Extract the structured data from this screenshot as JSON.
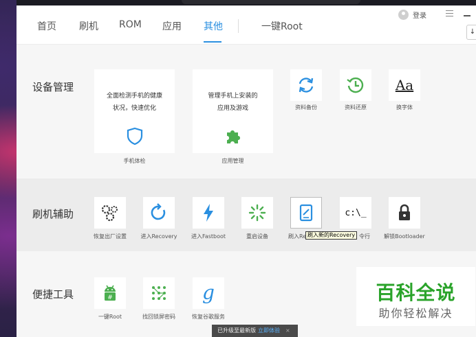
{
  "header": {
    "tabs": [
      {
        "label": "首页"
      },
      {
        "label": "刷机"
      },
      {
        "label": "ROM"
      },
      {
        "label": "应用"
      },
      {
        "label": "其他"
      },
      {
        "label": "一键Root"
      }
    ],
    "active_tab": "其他",
    "login_label": "登录"
  },
  "sections": {
    "device": {
      "title": "设备管理",
      "big_cards": [
        {
          "desc_line1": "全面检测手机的健康",
          "desc_line2": "状况，快速优化",
          "label": "手机体检",
          "icon": "shield-icon"
        },
        {
          "desc_line1": "管理手机上安装的",
          "desc_line2": "应用及游戏",
          "label": "应用管理",
          "icon": "puzzle-icon"
        }
      ],
      "tools": [
        {
          "label": "资料备份",
          "icon": "sync-icon"
        },
        {
          "label": "资料还原",
          "icon": "history-icon"
        },
        {
          "label": "换字体",
          "icon": "font-icon",
          "glyph": "Aa"
        }
      ]
    },
    "flash": {
      "title": "刷机辅助",
      "tools": [
        {
          "label": "恢复出厂设置",
          "icon": "gears-icon"
        },
        {
          "label": "进入Recovery",
          "icon": "refresh-icon"
        },
        {
          "label": "进入Fastboot",
          "icon": "lightning-icon"
        },
        {
          "label": "重启设备",
          "icon": "loading-icon"
        },
        {
          "label": "刷入Re",
          "icon": "tablet-edit-icon"
        },
        {
          "label": "令行",
          "icon": "cmd-icon",
          "glyph": "c:\\_"
        },
        {
          "label": "解锁Bootloader",
          "icon": "lock-icon"
        }
      ],
      "tooltip": "刷入新的Recovery"
    },
    "tools": {
      "title": "便捷工具",
      "tools": [
        {
          "label": "一键Root",
          "icon": "android-icon"
        },
        {
          "label": "找回锁屏密码",
          "icon": "pattern-icon"
        },
        {
          "label": "恢复谷歌服务",
          "icon": "google-icon",
          "glyph": "g"
        }
      ]
    }
  },
  "watermark": {
    "line1": "百科全说",
    "line2": "助你轻松解决"
  },
  "upgrade_bar": {
    "text": "已升级至最新版",
    "link": "立即体验",
    "close": "×"
  },
  "colors": {
    "accent": "#2a8fe0",
    "green": "#4caf50",
    "dark_icon": "#333333"
  }
}
